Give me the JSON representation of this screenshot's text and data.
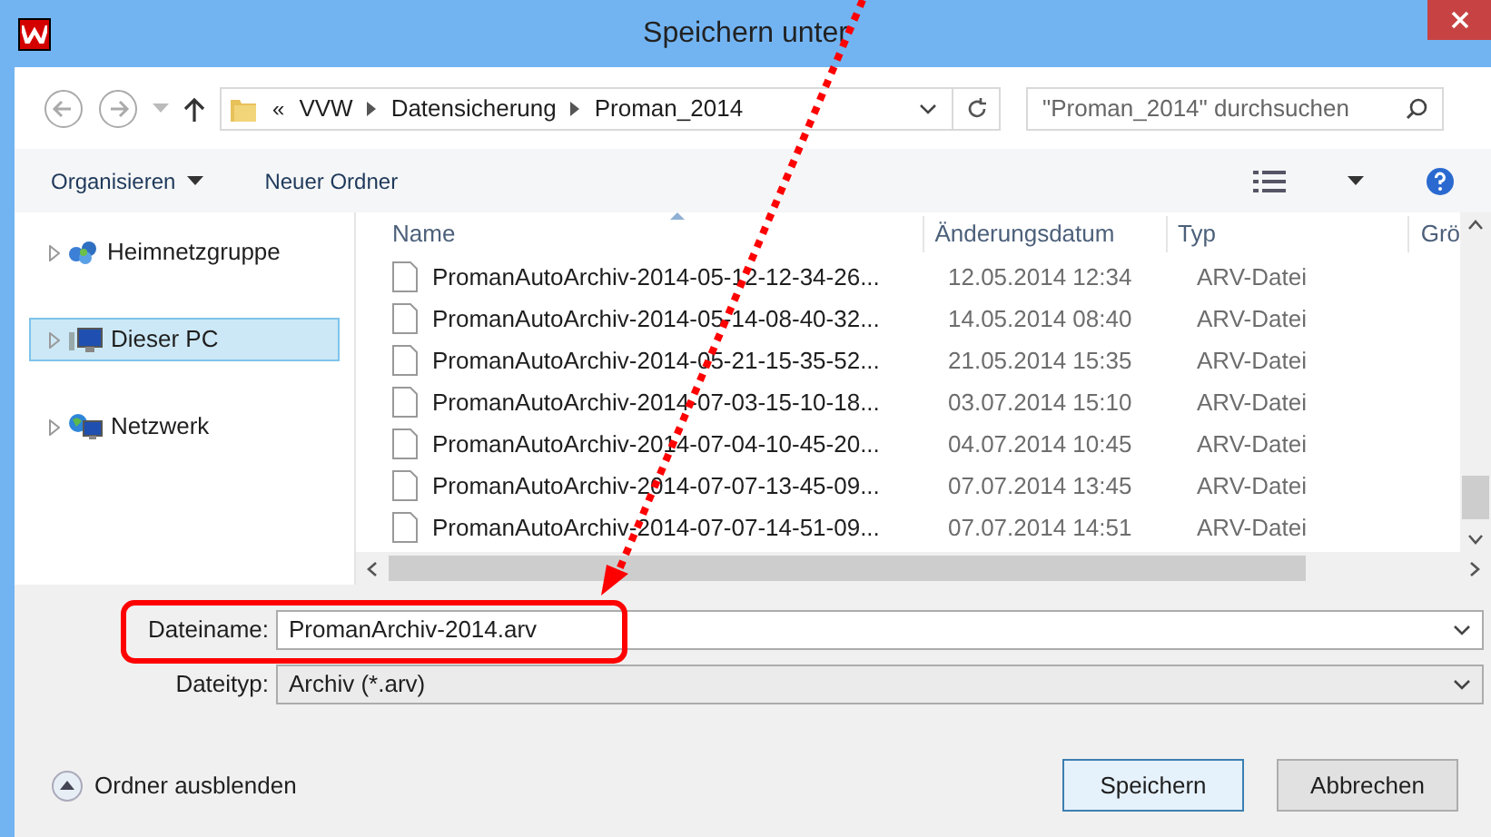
{
  "window": {
    "title": "Speichern unter"
  },
  "navigation": {
    "breadcrumb_prefix": "«",
    "path": [
      "VVW",
      "Datensicherung",
      "Proman_2014"
    ],
    "search": {
      "placeholder": "\"Proman_2014\" durchsuchen"
    }
  },
  "toolbar": {
    "items": [
      "Organisieren",
      "Neuer Ordner"
    ]
  },
  "sidebar": {
    "items": [
      {
        "label": "Heimnetzgruppe",
        "kind": "homegroup",
        "selected": false
      },
      {
        "label": "Dieser PC",
        "kind": "pc",
        "selected": true
      },
      {
        "label": "Netzwerk",
        "kind": "network",
        "selected": false
      }
    ]
  },
  "table": {
    "columns": [
      "Name",
      "Änderungsdatum",
      "Typ",
      "Grö"
    ],
    "rows": [
      [
        "PromanAutoArchiv-2014-05-12-12-34-26...",
        "12.05.2014 12:34",
        "ARV-Datei"
      ],
      [
        "PromanAutoArchiv-2014-05-14-08-40-32...",
        "14.05.2014 08:40",
        "ARV-Datei"
      ],
      [
        "PromanAutoArchiv-2014-05-21-15-35-52...",
        "21.05.2014 15:35",
        "ARV-Datei"
      ],
      [
        "PromanAutoArchiv-2014-07-03-15-10-18...",
        "03.07.2014 15:10",
        "ARV-Datei"
      ],
      [
        "PromanAutoArchiv-2014-07-04-10-45-20...",
        "04.07.2014 10:45",
        "ARV-Datei"
      ],
      [
        "PromanAutoArchiv-2014-07-07-13-45-09...",
        "07.07.2014 13:45",
        "ARV-Datei"
      ],
      [
        "PromanAutoArchiv-2014-07-07-14-51-09...",
        "07.07.2014 14:51",
        "ARV-Datei"
      ]
    ]
  },
  "form": {
    "filename": {
      "label": "Dateiname:",
      "value": "PromanArchiv-2014.arv"
    },
    "filetype": {
      "label": "Dateityp:",
      "value": "Archiv (*.arv)"
    }
  },
  "footer": {
    "toggle": "Ordner ausblenden",
    "buttons": [
      {
        "label": "Speichern",
        "default": true
      },
      {
        "label": "Abbrechen",
        "default": false
      }
    ]
  }
}
